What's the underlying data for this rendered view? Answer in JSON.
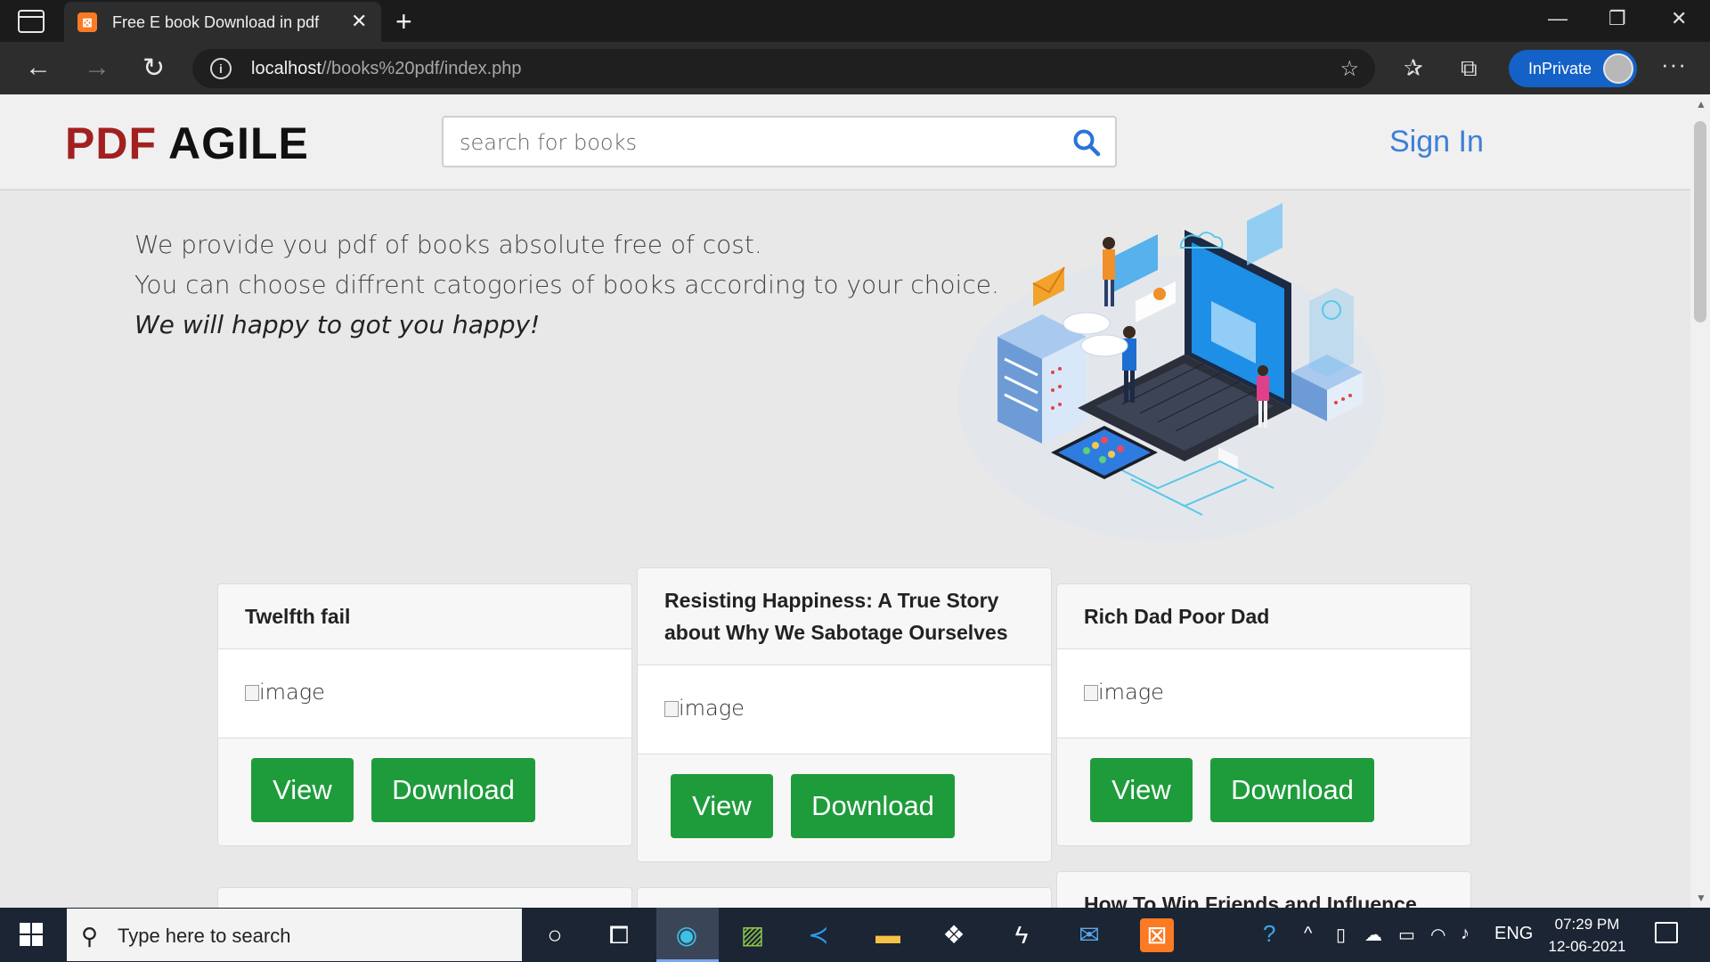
{
  "browser": {
    "tab_title": "Free E book Download in pdf",
    "tab_close": "✕",
    "new_tab": "+",
    "url_host": "localhost",
    "url_path": "//books%20pdf/index.php",
    "inprivate_label": "InPrivate",
    "more": "···",
    "window_controls": [
      "—",
      "❐",
      "✕"
    ]
  },
  "header": {
    "logo_part1": "PDF",
    "logo_part2": "AGILE",
    "search_placeholder": "search for books",
    "signin_label": "Sign In"
  },
  "intro": {
    "line1": "We provide you pdf of books absolute free of cost.",
    "line2": "You can choose diffrent catogories of books according to your choice.",
    "tagline": "We will happy to got you happy!"
  },
  "cards": [
    {
      "title": "Twelfth fail",
      "image_alt": "image",
      "view_label": "View",
      "download_label": "Download"
    },
    {
      "title": "Resisting Happiness: A True Story about Why We Sabotage Ourselves",
      "image_alt": "image",
      "view_label": "View",
      "download_label": "Download"
    },
    {
      "title": "Rich Dad Poor Dad",
      "image_alt": "image",
      "view_label": "View",
      "download_label": "Download"
    },
    {
      "title": "How To Win Friends and Influence"
    }
  ],
  "taskbar": {
    "search_placeholder": "Type here to search",
    "language": "ENG",
    "time": "07:29 PM",
    "date": "12-06-2021"
  },
  "colors": {
    "download_green": "#1e9c3b",
    "logo_red": "#a32020",
    "signin_blue": "#3d7fd6",
    "inprivate_blue": "#1462c7"
  }
}
